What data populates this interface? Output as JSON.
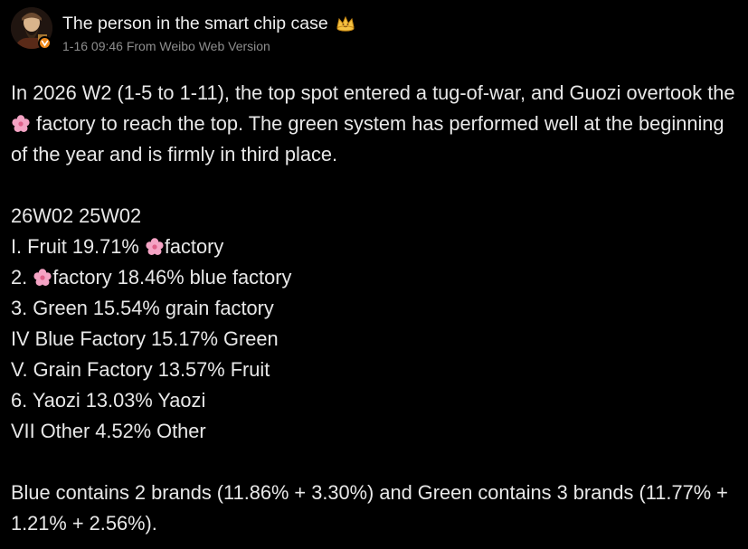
{
  "user": {
    "name": "The person in the smart chip case",
    "timestamp": "1-16 09:46",
    "source": "From Weibo Web Version",
    "avatar_icon": "avatar-portrait",
    "badge_icon": "verified-badge-icon",
    "crown_icon": "crown-icon"
  },
  "post": {
    "intro": {
      "p1": "In 2026 W2 (1-5 to 1-11), the top spot entered a tug-of-war, and Guozi overtook the ",
      "p2": " factory to reach the top. The green system has performed well at the beginning of the year and is firmly in third place."
    },
    "header_line": "26W02 25W02",
    "rankings": {
      "r1a": "I. Fruit 19.71% ",
      "r1b": "factory",
      "r2a": "2. ",
      "r2b": "factory 18.46% blue factory",
      "r3": "3. Green 15.54% grain factory",
      "r4": "IV Blue Factory 15.17% Green",
      "r5": "V. Grain Factory 13.57% Fruit",
      "r6": "6. Yaozi 13.03% Yaozi",
      "r7": "VII Other 4.52% Other"
    },
    "footer": "Blue contains 2 brands (11.86% + 3.30%) and Green contains 3 brands (11.77% + 1.21% + 2.56%)."
  },
  "colors": {
    "background": "#000000",
    "text": "#e8e8e8",
    "meta": "#8e8e8e",
    "badge": "#f08a1c",
    "flower": "#f4a3c4"
  }
}
